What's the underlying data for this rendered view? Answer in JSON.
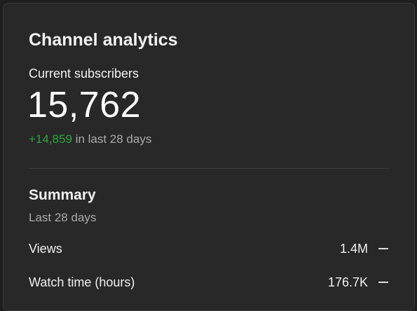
{
  "card": {
    "title": "Channel analytics"
  },
  "subscribers": {
    "label": "Current subscribers",
    "count": "15,762",
    "change": "+14,859",
    "change_suffix": " in last 28 days"
  },
  "summary": {
    "title": "Summary",
    "period": "Last 28 days",
    "metrics": [
      {
        "label": "Views",
        "value": "1.4M",
        "trend_icon": "dash-icon"
      },
      {
        "label": "Watch time (hours)",
        "value": "176.7K",
        "trend_icon": "dash-icon"
      }
    ]
  },
  "colors": {
    "background": "#282828",
    "positive": "#2ba640",
    "muted_text": "#aaaaaa"
  }
}
